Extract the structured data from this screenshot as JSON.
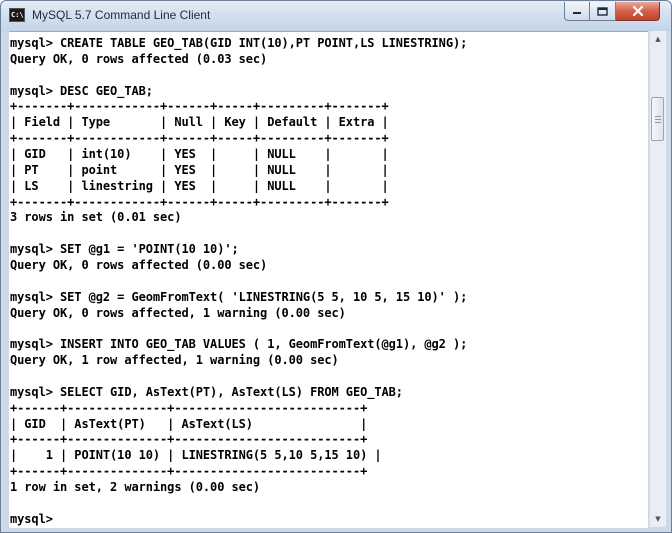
{
  "window": {
    "title": "MySQL 5.7 Command Line Client",
    "icon": "console-icon",
    "icon_text": "C:\\"
  },
  "controls": {
    "minimize_icon": "minimize-icon",
    "maximize_icon": "maximize-icon",
    "close_icon": "close-icon"
  },
  "scrollbar": {
    "up_glyph": "▲",
    "down_glyph": "▼"
  },
  "console": {
    "lines": [
      "mysql> CREATE TABLE GEO_TAB(GID INT(10),PT POINT,LS LINESTRING);",
      "Query OK, 0 rows affected (0.03 sec)",
      "",
      "mysql> DESC GEO_TAB;",
      "+-------+------------+------+-----+---------+-------+",
      "| Field | Type       | Null | Key | Default | Extra |",
      "+-------+------------+------+-----+---------+-------+",
      "| GID   | int(10)    | YES  |     | NULL    |       |",
      "| PT    | point      | YES  |     | NULL    |       |",
      "| LS    | linestring | YES  |     | NULL    |       |",
      "+-------+------------+------+-----+---------+-------+",
      "3 rows in set (0.01 sec)",
      "",
      "mysql> SET @g1 = 'POINT(10 10)';",
      "Query OK, 0 rows affected (0.00 sec)",
      "",
      "mysql> SET @g2 = GeomFromText( 'LINESTRING(5 5, 10 5, 15 10)' );",
      "Query OK, 0 rows affected, 1 warning (0.00 sec)",
      "",
      "mysql> INSERT INTO GEO_TAB VALUES ( 1, GeomFromText(@g1), @g2 );",
      "Query OK, 1 row affected, 1 warning (0.00 sec)",
      "",
      "mysql> SELECT GID, AsText(PT), AsText(LS) FROM GEO_TAB;",
      "+------+--------------+--------------------------+",
      "| GID  | AsText(PT)   | AsText(LS)               |",
      "+------+--------------+--------------------------+",
      "|    1 | POINT(10 10) | LINESTRING(5 5,10 5,15 10) |",
      "+------+--------------+--------------------------+",
      "1 row in set, 2 warnings (0.00 sec)",
      "",
      "mysql>"
    ]
  }
}
